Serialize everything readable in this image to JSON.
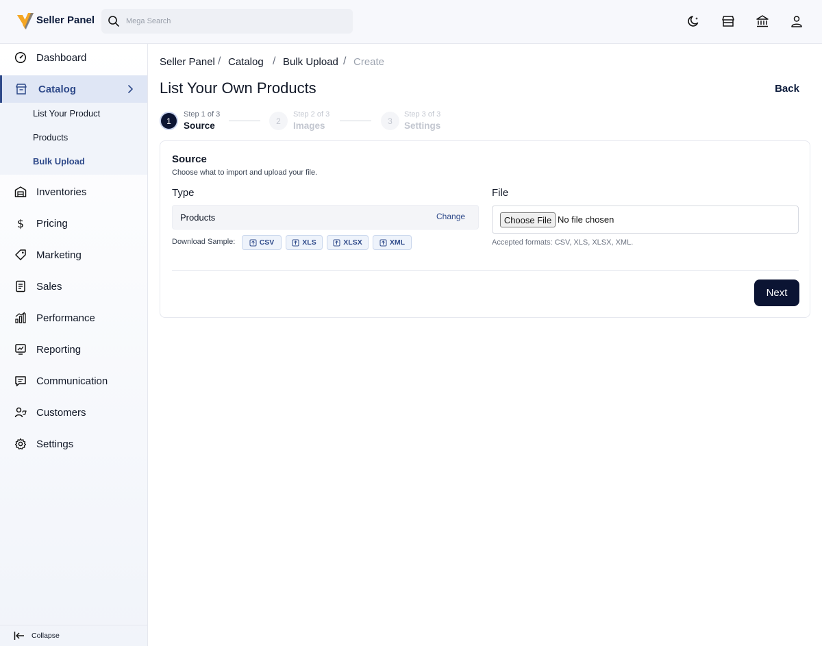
{
  "app": {
    "brand": "Seller Panel"
  },
  "search": {
    "placeholder": "Mega Search",
    "value": ""
  },
  "topbar_icons": [
    "moon-icon",
    "store-icon",
    "bank-icon",
    "user-icon"
  ],
  "sidebar": {
    "items": [
      {
        "label": "Dashboard",
        "icon": "dashboard-icon"
      },
      {
        "label": "Catalog",
        "icon": "catalog-icon",
        "active": true
      },
      {
        "label": "Inventories",
        "icon": "warehouse-icon"
      },
      {
        "label": "Pricing",
        "icon": "dollar-icon"
      },
      {
        "label": "Marketing",
        "icon": "tag-icon"
      },
      {
        "label": "Sales",
        "icon": "receipt-icon"
      },
      {
        "label": "Performance",
        "icon": "bar-chart-icon"
      },
      {
        "label": "Reporting",
        "icon": "report-icon"
      },
      {
        "label": "Communication",
        "icon": "chat-icon"
      },
      {
        "label": "Customers",
        "icon": "customers-icon"
      },
      {
        "label": "Settings",
        "icon": "gear-icon"
      }
    ],
    "catalog_sub": [
      {
        "label": "List Your Product"
      },
      {
        "label": "Products"
      },
      {
        "label": "Bulk Upload",
        "active": true
      }
    ],
    "collapse_label": "Collapse"
  },
  "breadcrumb": {
    "items": [
      "Seller Panel",
      "Catalog",
      "Bulk Upload",
      "Create"
    ],
    "separator": "/"
  },
  "page": {
    "title": "List Your Own Products",
    "back_label": "Back"
  },
  "stepper": {
    "steps": [
      {
        "number": "1",
        "small": "Step 1 of 3",
        "label": "Source",
        "active": true
      },
      {
        "number": "2",
        "small": "Step 2 of 3",
        "label": "Images",
        "active": false
      },
      {
        "number": "3",
        "small": "Step 3 of 3",
        "label": "Settings",
        "active": false
      }
    ]
  },
  "card": {
    "title": "Source",
    "description": "Choose what to import and upload your file.",
    "type_label": "Type",
    "type_value": "Products",
    "change_label": "Change",
    "download_label": "Download Sample:",
    "samples": [
      "CSV",
      "XLS",
      "XLSX",
      "XML"
    ],
    "file_label": "File",
    "choose_file_label": "Choose File",
    "no_file_text": "No file chosen",
    "accepted_text": "Accepted formats: CSV, XLS, XLSX, XML.",
    "next_label": "Next"
  },
  "colors": {
    "accent": "#2f4a8a",
    "primary_dark": "#0b1433",
    "logo_orange": "#f5a623",
    "logo_blue": "#2f5fb3"
  }
}
